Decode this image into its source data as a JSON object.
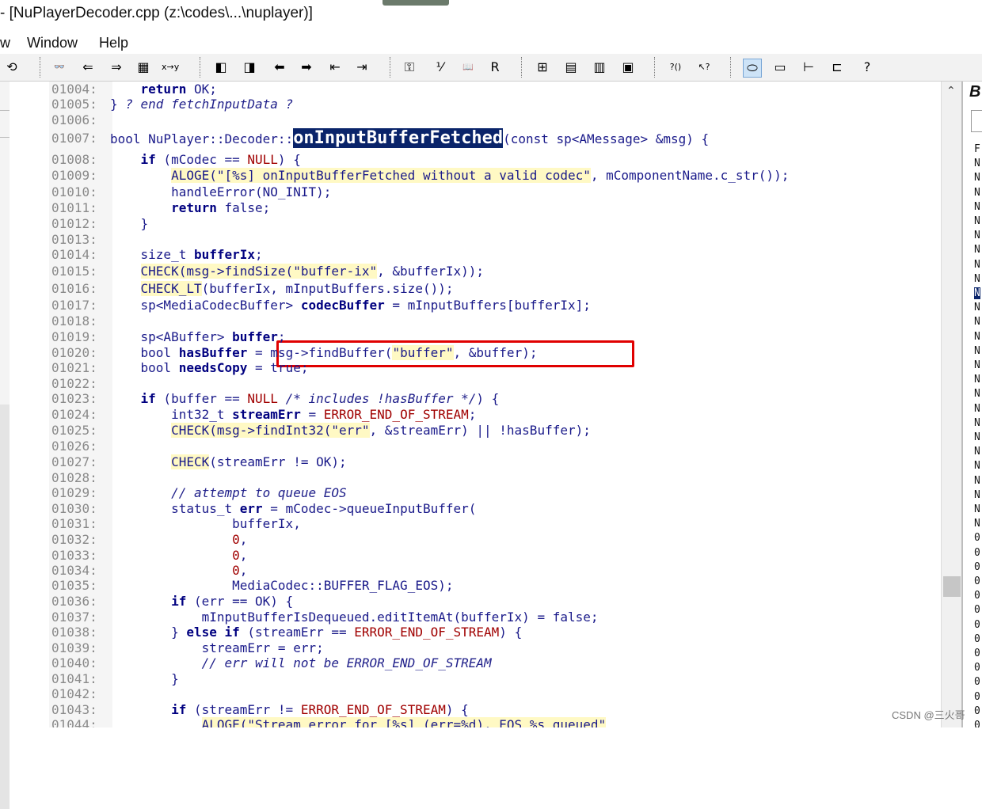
{
  "window": {
    "title": "- [NuPlayerDecoder.cpp (z:\\codes\\...\\nuplayer)]"
  },
  "menubar": {
    "items": [
      "w",
      "Window",
      "Help"
    ]
  },
  "toolbar": {
    "buttons": [
      {
        "icon": "redo-icon",
        "glyph": "⟲"
      },
      {
        "icon": "binoculars-icon",
        "glyph": "👓"
      },
      {
        "icon": "find-prev-icon",
        "glyph": "⇐"
      },
      {
        "icon": "find-next-icon",
        "glyph": "⇒"
      },
      {
        "icon": "find-files-icon",
        "glyph": "▦"
      },
      {
        "icon": "replace-icon",
        "glyph": "x→y"
      },
      {
        "icon": "bookmark-prev-icon",
        "glyph": "◧"
      },
      {
        "icon": "bookmark-next-icon",
        "glyph": "◨"
      },
      {
        "icon": "back-arrow-icon",
        "glyph": "⬅"
      },
      {
        "icon": "forward-arrow-icon",
        "glyph": "➡"
      },
      {
        "icon": "jump-back-icon",
        "glyph": "⇤"
      },
      {
        "icon": "jump-forward-icon",
        "glyph": "⇥"
      },
      {
        "icon": "symbol-icon",
        "glyph": "⚿"
      },
      {
        "icon": "relation-icon",
        "glyph": "⅟"
      },
      {
        "icon": "book-icon",
        "glyph": "📖"
      },
      {
        "icon": "r-icon",
        "glyph": "R"
      },
      {
        "icon": "layout-1-icon",
        "glyph": "⊞"
      },
      {
        "icon": "layout-2-icon",
        "glyph": "▤"
      },
      {
        "icon": "layout-3-icon",
        "glyph": "▥"
      },
      {
        "icon": "layout-4-icon",
        "glyph": "▣"
      },
      {
        "icon": "help-context-icon",
        "glyph": "?()"
      },
      {
        "icon": "pointer-help-icon",
        "glyph": "↖?"
      },
      {
        "icon": "sync-icon",
        "glyph": "⬭"
      },
      {
        "icon": "panel-icon",
        "glyph": "▭"
      },
      {
        "icon": "tree-icon",
        "glyph": "⊢"
      },
      {
        "icon": "outline-icon",
        "glyph": "⊏"
      },
      {
        "icon": "info-icon",
        "glyph": "?"
      }
    ]
  },
  "editor": {
    "lines": [
      {
        "n": "01004:",
        "segs": [
          [
            "pl",
            "    "
          ],
          [
            "kw",
            "return"
          ],
          [
            "pl",
            " OK;"
          ]
        ]
      },
      {
        "n": "01005:",
        "segs": [
          [
            "pl",
            "} "
          ],
          [
            "cm",
            "? end fetchInputData ?"
          ]
        ]
      },
      {
        "n": "01006:",
        "segs": []
      },
      {
        "n": "01007:",
        "segs": [
          [
            "pl",
            "bool NuPlayer::Decoder::"
          ],
          [
            "sel",
            "onInputBufferFetched"
          ],
          [
            "pl",
            "(const sp<AMessage> &msg) {"
          ]
        ]
      },
      {
        "n": "01008:",
        "segs": [
          [
            "pl",
            "    "
          ],
          [
            "kw",
            "if"
          ],
          [
            "pl",
            " (mCodec == "
          ],
          [
            "mac",
            "NULL"
          ],
          [
            "pl",
            ") {"
          ]
        ]
      },
      {
        "n": "01009:",
        "segs": [
          [
            "pl",
            "        "
          ],
          [
            "str",
            "ALOGE(\"[%s] onInputBufferFetched without a valid codec\""
          ],
          [
            "pl",
            ", mComponentName.c_str());"
          ]
        ]
      },
      {
        "n": "01010:",
        "segs": [
          [
            "pl",
            "        handleError(NO_INIT);"
          ]
        ]
      },
      {
        "n": "01011:",
        "segs": [
          [
            "pl",
            "        "
          ],
          [
            "kw",
            "return"
          ],
          [
            "pl",
            " false;"
          ]
        ]
      },
      {
        "n": "01012:",
        "segs": [
          [
            "pl",
            "    }"
          ]
        ]
      },
      {
        "n": "01013:",
        "segs": []
      },
      {
        "n": "01014:",
        "segs": [
          [
            "pl",
            "    size_t "
          ],
          [
            "bold",
            "bufferIx"
          ],
          [
            "pl",
            ";"
          ]
        ]
      },
      {
        "n": "01015:",
        "segs": [
          [
            "pl",
            "    "
          ],
          [
            "str",
            "CHECK(msg->findSize(\"buffer-ix\""
          ],
          [
            "pl",
            ", &bufferIx));"
          ]
        ]
      },
      {
        "n": "01016:",
        "segs": [
          [
            "pl",
            "    "
          ],
          [
            "str",
            "CHECK_LT"
          ],
          [
            "pl",
            "(bufferIx, mInputBuffers.size());"
          ]
        ]
      },
      {
        "n": "01017:",
        "segs": [
          [
            "pl",
            "    sp<MediaCodecBuffer> "
          ],
          [
            "bold",
            "codecBuffer"
          ],
          [
            "pl",
            " = mInputBuffers[bufferIx];"
          ]
        ]
      },
      {
        "n": "01018:",
        "segs": []
      },
      {
        "n": "01019:",
        "segs": [
          [
            "pl",
            "    sp<ABuffer> "
          ],
          [
            "bold",
            "buffer"
          ],
          [
            "pl",
            ";"
          ]
        ]
      },
      {
        "n": "01020:",
        "segs": [
          [
            "pl",
            "    bool "
          ],
          [
            "bold",
            "hasBuffer"
          ],
          [
            "pl",
            " = msg->findBuffer("
          ],
          [
            "str",
            "\"buffer\""
          ],
          [
            "pl",
            ", &buffer);"
          ]
        ]
      },
      {
        "n": "01021:",
        "segs": [
          [
            "pl",
            "    bool "
          ],
          [
            "bold",
            "needsCopy"
          ],
          [
            "pl",
            " = true;"
          ]
        ]
      },
      {
        "n": "01022:",
        "segs": []
      },
      {
        "n": "01023:",
        "segs": [
          [
            "pl",
            "    "
          ],
          [
            "kw",
            "if"
          ],
          [
            "pl",
            " (buffer == "
          ],
          [
            "mac",
            "NULL"
          ],
          [
            "pl",
            " "
          ],
          [
            "cm",
            "/* includes !hasBuffer */"
          ],
          [
            "pl",
            ") {"
          ]
        ]
      },
      {
        "n": "01024:",
        "segs": [
          [
            "pl",
            "        int32_t "
          ],
          [
            "bold",
            "streamErr"
          ],
          [
            "pl",
            " = "
          ],
          [
            "mac",
            "ERROR_END_OF_STREAM"
          ],
          [
            "pl",
            ";"
          ]
        ]
      },
      {
        "n": "01025:",
        "segs": [
          [
            "pl",
            "        "
          ],
          [
            "str",
            "CHECK(msg->findInt32(\"err\""
          ],
          [
            "pl",
            ", &streamErr) || !hasBuffer);"
          ]
        ]
      },
      {
        "n": "01026:",
        "segs": []
      },
      {
        "n": "01027:",
        "segs": [
          [
            "pl",
            "        "
          ],
          [
            "str",
            "CHECK"
          ],
          [
            "pl",
            "(streamErr != OK);"
          ]
        ]
      },
      {
        "n": "01028:",
        "segs": []
      },
      {
        "n": "01029:",
        "segs": [
          [
            "pl",
            "        "
          ],
          [
            "cm",
            "// attempt to queue EOS"
          ]
        ]
      },
      {
        "n": "01030:",
        "segs": [
          [
            "pl",
            "        status_t "
          ],
          [
            "bold",
            "err"
          ],
          [
            "pl",
            " = mCodec->queueInputBuffer("
          ]
        ]
      },
      {
        "n": "01031:",
        "segs": [
          [
            "pl",
            "                bufferIx,"
          ]
        ]
      },
      {
        "n": "01032:",
        "segs": [
          [
            "pl",
            "                "
          ],
          [
            "mac",
            "0"
          ],
          [
            "pl",
            ","
          ]
        ]
      },
      {
        "n": "01033:",
        "segs": [
          [
            "pl",
            "                "
          ],
          [
            "mac",
            "0"
          ],
          [
            "pl",
            ","
          ]
        ]
      },
      {
        "n": "01034:",
        "segs": [
          [
            "pl",
            "                "
          ],
          [
            "mac",
            "0"
          ],
          [
            "pl",
            ","
          ]
        ]
      },
      {
        "n": "01035:",
        "segs": [
          [
            "pl",
            "                MediaCodec::BUFFER_FLAG_EOS);"
          ]
        ]
      },
      {
        "n": "01036:",
        "segs": [
          [
            "pl",
            "        "
          ],
          [
            "kw",
            "if"
          ],
          [
            "pl",
            " (err == OK) {"
          ]
        ]
      },
      {
        "n": "01037:",
        "segs": [
          [
            "pl",
            "            mInputBufferIsDequeued.editItemAt(bufferIx) = false;"
          ]
        ]
      },
      {
        "n": "01038:",
        "segs": [
          [
            "pl",
            "        } "
          ],
          [
            "kw",
            "else if"
          ],
          [
            "pl",
            " (streamErr == "
          ],
          [
            "mac",
            "ERROR_END_OF_STREAM"
          ],
          [
            "pl",
            ") {"
          ]
        ]
      },
      {
        "n": "01039:",
        "segs": [
          [
            "pl",
            "            streamErr = err;"
          ]
        ]
      },
      {
        "n": "01040:",
        "segs": [
          [
            "pl",
            "            "
          ],
          [
            "cm",
            "// err will not be ERROR_END_OF_STREAM"
          ]
        ]
      },
      {
        "n": "01041:",
        "segs": [
          [
            "pl",
            "        }"
          ]
        ]
      },
      {
        "n": "01042:",
        "segs": []
      },
      {
        "n": "01043:",
        "segs": [
          [
            "pl",
            "        "
          ],
          [
            "kw",
            "if"
          ],
          [
            "pl",
            " (streamErr != "
          ],
          [
            "mac",
            "ERROR_END_OF_STREAM"
          ],
          [
            "pl",
            ") {"
          ]
        ]
      },
      {
        "n": "01044:",
        "segs": [
          [
            "pl",
            "            "
          ],
          [
            "str",
            "ALOGE(\"Stream error for [%s] (err=%d), EOS %s queued\""
          ]
        ]
      }
    ]
  },
  "right_panel": {
    "title": "B",
    "items": [
      "F",
      "N",
      "N",
      "N",
      "N",
      "N",
      "N",
      "N",
      "N",
      "N",
      "N",
      "N",
      "N",
      "N",
      "N",
      "N",
      "N",
      "N",
      "N",
      "N",
      "N",
      "N",
      "N",
      "N",
      "N",
      "N",
      "N",
      "0",
      "0",
      "0",
      "0",
      "0",
      "0",
      "0",
      "0",
      "0",
      "0",
      "0",
      "0",
      "0",
      "0"
    ],
    "selected_index": 10
  },
  "watermark": "CSDN @三火哥"
}
